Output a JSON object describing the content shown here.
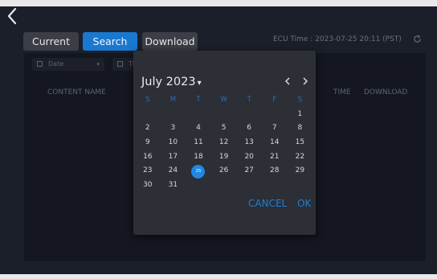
{
  "toolbar": {
    "current_label": "Current",
    "search_label": "Search",
    "download_label": "Download",
    "ecu_time": "ECU Time : 2023-07-25 20:11 (PST)",
    "refresh_icon": "refresh-icon",
    "back_icon": "chevron-left-icon"
  },
  "filters": {
    "date_label": "Date",
    "time_label": "Ti"
  },
  "table": {
    "headers": [
      "CONTENT NAME",
      "TIME",
      "DOWNLOAD"
    ]
  },
  "datepicker": {
    "month_title": "July 2023",
    "caret": "▾",
    "weekdays": [
      "S",
      "M",
      "T",
      "W",
      "T",
      "F",
      "S"
    ],
    "leading_blanks": 6,
    "days": [
      "1",
      "2",
      "3",
      "4",
      "5",
      "6",
      "7",
      "8",
      "9",
      "10",
      "11",
      "12",
      "13",
      "14",
      "15",
      "16",
      "17",
      "18",
      "19",
      "20",
      "21",
      "22",
      "23",
      "24",
      "25",
      "26",
      "27",
      "28",
      "29",
      "30",
      "31"
    ],
    "selected_day": "25",
    "cancel_label": "CANCEL",
    "ok_label": "OK"
  },
  "colors": {
    "accent": "#1e88e5",
    "search_button": "#1a78d1",
    "background": "#1b1f2a",
    "picker_bg": "#2c2f36"
  }
}
